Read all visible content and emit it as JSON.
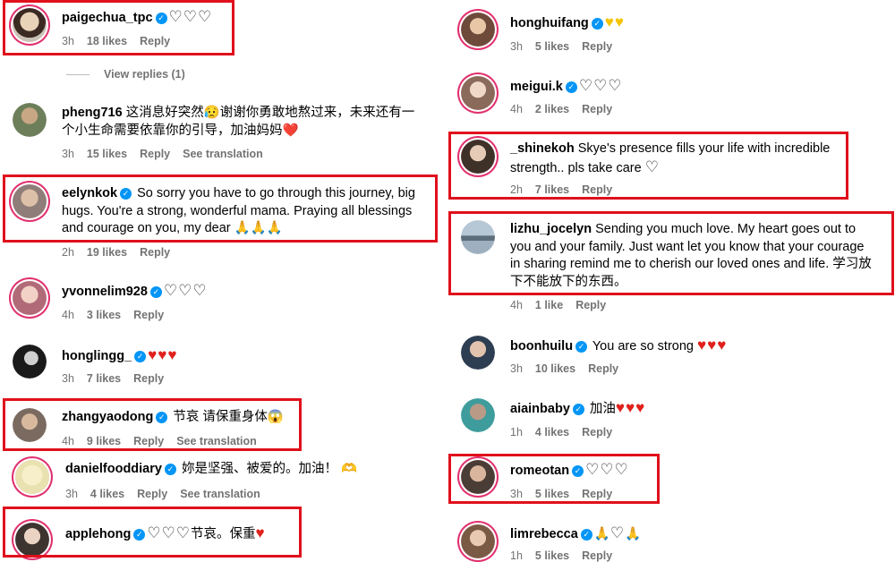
{
  "labels": {
    "reply": "Reply",
    "see_translation": "See translation",
    "view_replies": "View replies (1)"
  },
  "left": [
    {
      "user": "paigechua_tpc",
      "text": "",
      "time": "3h",
      "likes": "18 likes"
    },
    {
      "user": "pheng716",
      "text_l1": "这消息好突然😥谢谢你勇敢地熬过来，未来还有一",
      "text_l2": "个小生命需要依靠你的引导，加油妈妈❤️",
      "time": "3h",
      "likes": "15 likes"
    },
    {
      "user": "eelynkok",
      "text_l1": "So sorry you have to go through this journey, big",
      "text_l2": "hugs. You're a strong, wonderful mama. Praying all blessings",
      "text_l3": "and courage on you, my dear 🙏🙏🙏",
      "time": "2h",
      "likes": "19 likes"
    },
    {
      "user": "yvonnelim928",
      "time": "4h",
      "likes": "3 likes"
    },
    {
      "user": "honglingg_",
      "time": "3h",
      "likes": "7 likes"
    },
    {
      "user": "zhangyaodong",
      "text": "节哀 请保重身体😱",
      "time": "4h",
      "likes": "9 likes"
    },
    {
      "user": "danielfooddiary",
      "text": "妳是坚强、被爱的。加油！ 🫶",
      "time": "3h",
      "likes": "4 likes"
    },
    {
      "user": "applehong",
      "text": "节哀。保重",
      "time": "",
      "likes": ""
    }
  ],
  "right": [
    {
      "user": "honghuifang",
      "time": "3h",
      "likes": "5 likes"
    },
    {
      "user": "meigui.k",
      "time": "4h",
      "likes": "2 likes"
    },
    {
      "user": "_shinekoh",
      "text_l1": "Skye's presence fills your life with incredible",
      "text_l2": "strength.. pls take care",
      "time": "2h",
      "likes": "7 likes"
    },
    {
      "user": "lizhu_jocelyn",
      "text_l1": "Sending you much love. My heart goes out to",
      "text_l2": "you and your family. Just want let you know that your courage",
      "text_l3": "in sharing remind me to cherish our loved ones and life. 学习放",
      "text_l4": "下不能放下的东西。",
      "time": "4h",
      "likes": "1 like"
    },
    {
      "user": "boonhuilu",
      "text": "You are so strong",
      "time": "3h",
      "likes": "10 likes"
    },
    {
      "user": "aiainbaby",
      "text": "加油",
      "time": "1h",
      "likes": "4 likes"
    },
    {
      "user": "romeotan",
      "time": "3h",
      "likes": "5 likes"
    },
    {
      "user": "limrebecca",
      "time": "1h",
      "likes": "5 likes"
    }
  ]
}
